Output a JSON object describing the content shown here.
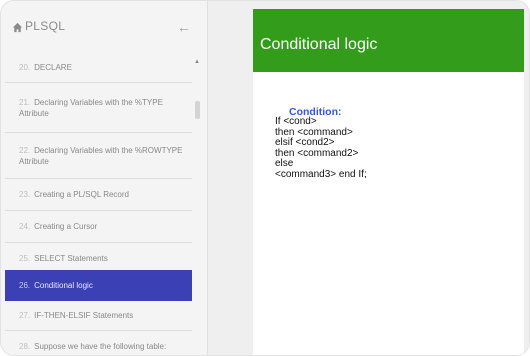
{
  "sidebar": {
    "title": "PLSQL",
    "items": [
      {
        "num": "20.",
        "label": "DECLARE"
      },
      {
        "num": "21.",
        "label": "Declaring Variables with the %TYPE Attribute"
      },
      {
        "num": "22.",
        "label": "Declaring Variables with the %ROWTYPE Attribute"
      },
      {
        "num": "23.",
        "label": "Creating a PL/SQL Record"
      },
      {
        "num": "24.",
        "label": "Creating a Cursor"
      },
      {
        "num": "25.",
        "label": "SELECT Statements"
      },
      {
        "num": "26.",
        "label": "Conditional logic"
      },
      {
        "num": "27.",
        "label": "IF-THEN-ELSIF Statements"
      },
      {
        "num": "28.",
        "label": "Suppose we have the following table:"
      }
    ],
    "active_index": 6
  },
  "slide": {
    "title": "Conditional logic",
    "condition_label": "Condition:",
    "code": [
      "If <cond>",
      "then <command>",
      "elsif <cond2>",
      "then <command2>",
      "else",
      "<command3> end If;"
    ]
  },
  "colors": {
    "header_green": "#339c1a",
    "active_item": "#3b40b4",
    "condition_blue": "#3355e8"
  },
  "icons": {
    "home": "home-icon",
    "back": "arrow-left-icon",
    "scroll_up": "chevron-up-icon"
  }
}
